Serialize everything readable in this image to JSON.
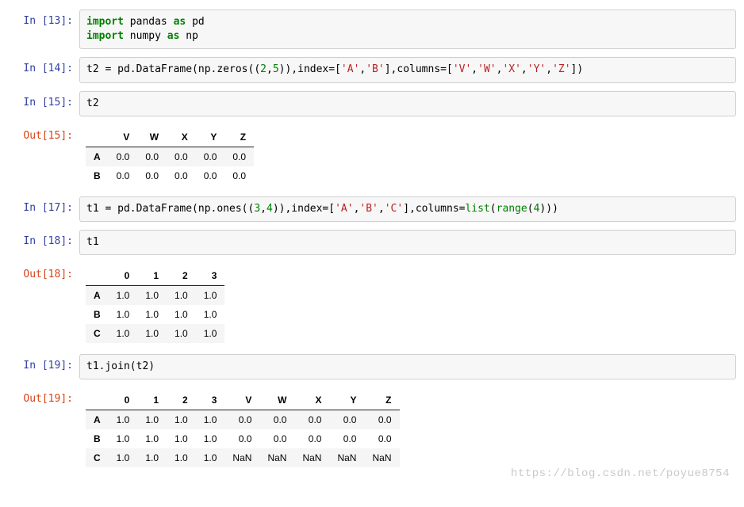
{
  "cells": [
    {
      "prompt_in": "In [13]:",
      "code_tokens": [
        [
          "kw",
          "import"
        ],
        [
          "sp",
          " "
        ],
        [
          "name",
          "pandas"
        ],
        [
          "sp",
          " "
        ],
        [
          "kw",
          "as"
        ],
        [
          "sp",
          " "
        ],
        [
          "name",
          "pd"
        ],
        [
          "nl"
        ],
        [
          "kw",
          "import"
        ],
        [
          "sp",
          " "
        ],
        [
          "name",
          "numpy"
        ],
        [
          "sp",
          " "
        ],
        [
          "kw",
          "as"
        ],
        [
          "sp",
          " "
        ],
        [
          "name",
          "np"
        ]
      ]
    },
    {
      "prompt_in": "In [14]:",
      "code_tokens": [
        [
          "name",
          "t2 = pd.DataFrame(np.zeros(("
        ],
        [
          "num",
          "2"
        ],
        [
          "name",
          ","
        ],
        [
          "num",
          "5"
        ],
        [
          "name",
          ")),index=["
        ],
        [
          "str",
          "'A'"
        ],
        [
          "name",
          ","
        ],
        [
          "str",
          "'B'"
        ],
        [
          "name",
          "],columns=["
        ],
        [
          "str",
          "'V'"
        ],
        [
          "name",
          ","
        ],
        [
          "str",
          "'W'"
        ],
        [
          "name",
          ","
        ],
        [
          "str",
          "'X'"
        ],
        [
          "name",
          ","
        ],
        [
          "str",
          "'Y'"
        ],
        [
          "name",
          ","
        ],
        [
          "str",
          "'Z'"
        ],
        [
          "name",
          "])"
        ]
      ]
    },
    {
      "prompt_in": "In [15]:",
      "code_tokens": [
        [
          "name",
          "t2"
        ]
      ],
      "prompt_out": "Out[15]:",
      "table": {
        "columns": [
          "V",
          "W",
          "X",
          "Y",
          "Z"
        ],
        "index": [
          "A",
          "B"
        ],
        "data": [
          [
            "0.0",
            "0.0",
            "0.0",
            "0.0",
            "0.0"
          ],
          [
            "0.0",
            "0.0",
            "0.0",
            "0.0",
            "0.0"
          ]
        ]
      }
    },
    {
      "prompt_in": "In [17]:",
      "code_tokens": [
        [
          "name",
          "t1 = pd.DataFrame(np.ones(("
        ],
        [
          "num",
          "3"
        ],
        [
          "name",
          ","
        ],
        [
          "num",
          "4"
        ],
        [
          "name",
          ")),index=["
        ],
        [
          "str",
          "'A'"
        ],
        [
          "name",
          ","
        ],
        [
          "str",
          "'B'"
        ],
        [
          "name",
          ","
        ],
        [
          "str",
          "'C'"
        ],
        [
          "name",
          "],columns="
        ],
        [
          "bi",
          "list"
        ],
        [
          "name",
          "("
        ],
        [
          "bi",
          "range"
        ],
        [
          "name",
          "("
        ],
        [
          "num",
          "4"
        ],
        [
          "name",
          ")))"
        ]
      ]
    },
    {
      "prompt_in": "In [18]:",
      "code_tokens": [
        [
          "name",
          "t1"
        ]
      ],
      "prompt_out": "Out[18]:",
      "table": {
        "columns": [
          "0",
          "1",
          "2",
          "3"
        ],
        "index": [
          "A",
          "B",
          "C"
        ],
        "data": [
          [
            "1.0",
            "1.0",
            "1.0",
            "1.0"
          ],
          [
            "1.0",
            "1.0",
            "1.0",
            "1.0"
          ],
          [
            "1.0",
            "1.0",
            "1.0",
            "1.0"
          ]
        ]
      }
    },
    {
      "prompt_in": "In [19]:",
      "code_tokens": [
        [
          "name",
          "t1.join(t2)"
        ]
      ],
      "prompt_out": "Out[19]:",
      "table": {
        "columns": [
          "0",
          "1",
          "2",
          "3",
          "V",
          "W",
          "X",
          "Y",
          "Z"
        ],
        "index": [
          "A",
          "B",
          "C"
        ],
        "data": [
          [
            "1.0",
            "1.0",
            "1.0",
            "1.0",
            "0.0",
            "0.0",
            "0.0",
            "0.0",
            "0.0"
          ],
          [
            "1.0",
            "1.0",
            "1.0",
            "1.0",
            "0.0",
            "0.0",
            "0.0",
            "0.0",
            "0.0"
          ],
          [
            "1.0",
            "1.0",
            "1.0",
            "1.0",
            "NaN",
            "NaN",
            "NaN",
            "NaN",
            "NaN"
          ]
        ]
      }
    }
  ],
  "watermark": "https://blog.csdn.net/poyue8754"
}
